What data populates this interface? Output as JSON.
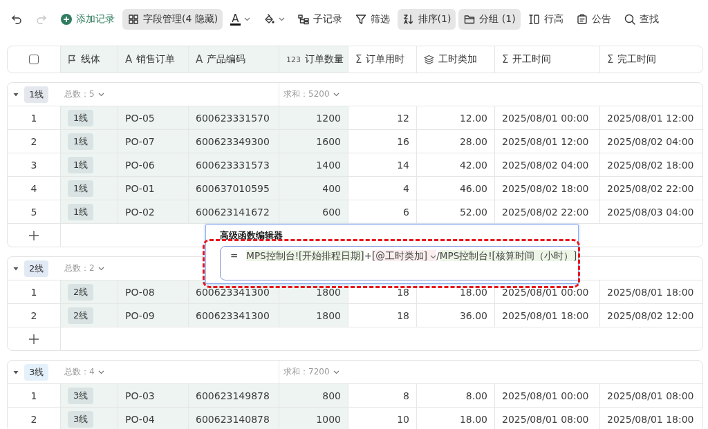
{
  "toolbar": [
    {
      "kind": "undo",
      "active": false,
      "disabled": false
    },
    {
      "kind": "redo",
      "active": false,
      "disabled": true
    },
    {
      "kind": "add",
      "label": "添加记录",
      "active": false,
      "disabled": false
    },
    {
      "kind": "fields",
      "label": "字段管理(4 隐藏)",
      "active": true,
      "disabled": false
    },
    {
      "kind": "text-color",
      "glyph": "A",
      "active": false,
      "disabled": false
    },
    {
      "kind": "fill-color",
      "active": false,
      "disabled": false
    },
    {
      "kind": "subrecord",
      "label": "子记录",
      "active": false,
      "disabled": false
    },
    {
      "kind": "filter",
      "label": "筛选",
      "active": false,
      "disabled": false
    },
    {
      "kind": "sort",
      "label": "排序(1)",
      "active": true,
      "disabled": false
    },
    {
      "kind": "group",
      "label": "分组 (1)",
      "active": true,
      "disabled": false
    },
    {
      "kind": "row-height",
      "label": "行高",
      "active": false,
      "disabled": false
    },
    {
      "kind": "notice",
      "label": "公告",
      "active": false,
      "disabled": false
    },
    {
      "kind": "search",
      "label": "查找",
      "active": false,
      "disabled": false
    }
  ],
  "table": {
    "select_all_checked": false,
    "columns": [
      {
        "label": "线体",
        "kind": "tag",
        "frozen": true
      },
      {
        "label": "销售订单",
        "glyph": "A",
        "kind": "text",
        "frozen": true
      },
      {
        "label": "产品编码",
        "glyph": "A",
        "kind": "text",
        "frozen": true
      },
      {
        "label": "订单数量",
        "glyph": "123",
        "kind": "number",
        "frozen": true
      },
      {
        "label": "订单用时",
        "glyph": "Σ",
        "kind": "number",
        "frozen": false
      },
      {
        "label": "工时类加",
        "kind": "number",
        "frozen": false
      },
      {
        "label": "开工时间",
        "glyph": "Σ",
        "kind": "text",
        "frozen": false
      },
      {
        "label": "完工时间",
        "glyph": "Σ",
        "kind": "text",
        "frozen": false
      }
    ],
    "groups": [
      {
        "name": "1线",
        "color": "#e4e8ee",
        "expanded": true,
        "add_row": true,
        "count_label": "总数：5",
        "sum_label": "求和：5200",
        "rows": [
          {
            "index": "1",
            "cells": [
              "1线",
              "PO-05",
              "600623331570",
              "1200",
              "12",
              "12.00",
              "2025/08/01 00:00",
              "2025/08/01 12:00"
            ]
          },
          {
            "index": "2",
            "cells": [
              "1线",
              "PO-07",
              "600623349300",
              "1600",
              "16",
              "28.00",
              "2025/08/01 12:00",
              "2025/08/02 04:00"
            ]
          },
          {
            "index": "3",
            "cells": [
              "1线",
              "PO-06",
              "600623331573",
              "1400",
              "14",
              "42.00",
              "2025/08/02 04:00",
              "2025/08/02 18:00"
            ]
          },
          {
            "index": "4",
            "cells": [
              "1线",
              "PO-01",
              "600637010595",
              "400",
              "4",
              "46.00",
              "2025/08/02 18:00",
              "2025/08/02 22:00"
            ]
          },
          {
            "index": "5",
            "cells": [
              "1线",
              "PO-02",
              "600623141672",
              "600",
              "6",
              "52.00",
              "2025/08/02 22:00",
              "2025/08/03 04:00"
            ]
          }
        ]
      },
      {
        "name": "2线",
        "color": "#e1e9f5",
        "expanded": true,
        "add_row": true,
        "count_label": "总数：2",
        "rows": [
          {
            "index": "1",
            "cells": [
              "2线",
              "PO-08",
              "600623341300",
              "1800",
              "18",
              "18.00",
              "2025/08/01 00:00",
              "2025/08/01 18:00"
            ]
          },
          {
            "index": "2",
            "cells": [
              "2线",
              "PO-09",
              "600623341300",
              "1800",
              "18",
              "36.00",
              "2025/08/01 18:00",
              "2025/08/02 12:00"
            ]
          }
        ]
      },
      {
        "name": "3线",
        "color": "#e4f1fb",
        "expanded": true,
        "add_row": false,
        "count_label": "总数：4",
        "sum_label": "求和：7200",
        "rows": [
          {
            "index": "1",
            "cells": [
              "3线",
              "PO-03",
              "600623149878",
              "800",
              "8",
              "8.00",
              "2025/08/01 00:00",
              "2025/08/01 08:00"
            ]
          },
          {
            "index": "2",
            "cells": [
              "3线",
              "PO-04",
              "600623140878",
              "1000",
              "10",
              "18.00",
              "2025/08/01 08:00",
              "2025/08/01 18:00"
            ]
          }
        ]
      }
    ]
  },
  "formula_editor": {
    "title": "高级函数编辑器",
    "tokens": [
      {
        "kind": "operator",
        "text": "="
      },
      {
        "kind": "ref",
        "text": "MPS控制台![开始排程日期]"
      },
      {
        "kind": "plain",
        "text": "+"
      },
      {
        "kind": "field",
        "text": "[@工时类加]"
      },
      {
        "kind": "plain",
        "text": "/"
      },
      {
        "kind": "ref",
        "text": "MPS控制台![核算时间（小时）]"
      }
    ]
  }
}
